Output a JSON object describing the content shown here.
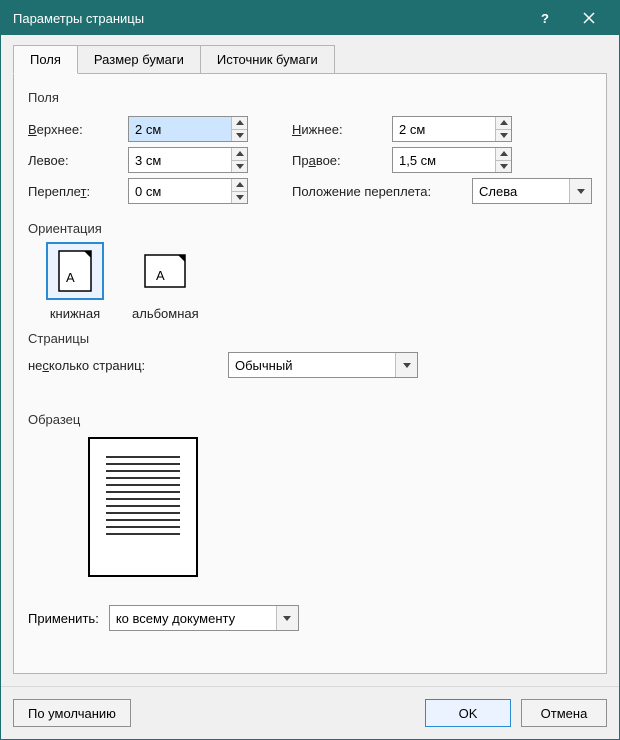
{
  "title": "Параметры страницы",
  "tabs": {
    "fields": "Поля",
    "paper_size": "Размер бумаги",
    "paper_source": "Источник бумаги"
  },
  "margins": {
    "section_label": "Поля",
    "top_label": "Верхнее:",
    "top_value": "2 см",
    "bottom_label": "Нижнее:",
    "bottom_value": "2 см",
    "left_label": "Левое:",
    "left_value": "3 см",
    "right_label": "Правое:",
    "right_value": "1,5 см",
    "gutter_label": "Переплет:",
    "gutter_value": "0 см",
    "gutter_pos_label": "Положение переплета:",
    "gutter_pos_value": "Слева"
  },
  "orientation": {
    "label": "Ориентация",
    "portrait": "книжная",
    "landscape": "альбомная"
  },
  "pages": {
    "label": "Страницы",
    "multi_label": "несколько страниц:",
    "multi_value": "Обычный"
  },
  "preview_label": "Образец",
  "apply": {
    "label": "Применить:",
    "value": "ко всему документу"
  },
  "buttons": {
    "default": "По умолчанию",
    "ok": "OK",
    "cancel": "Отмена"
  }
}
